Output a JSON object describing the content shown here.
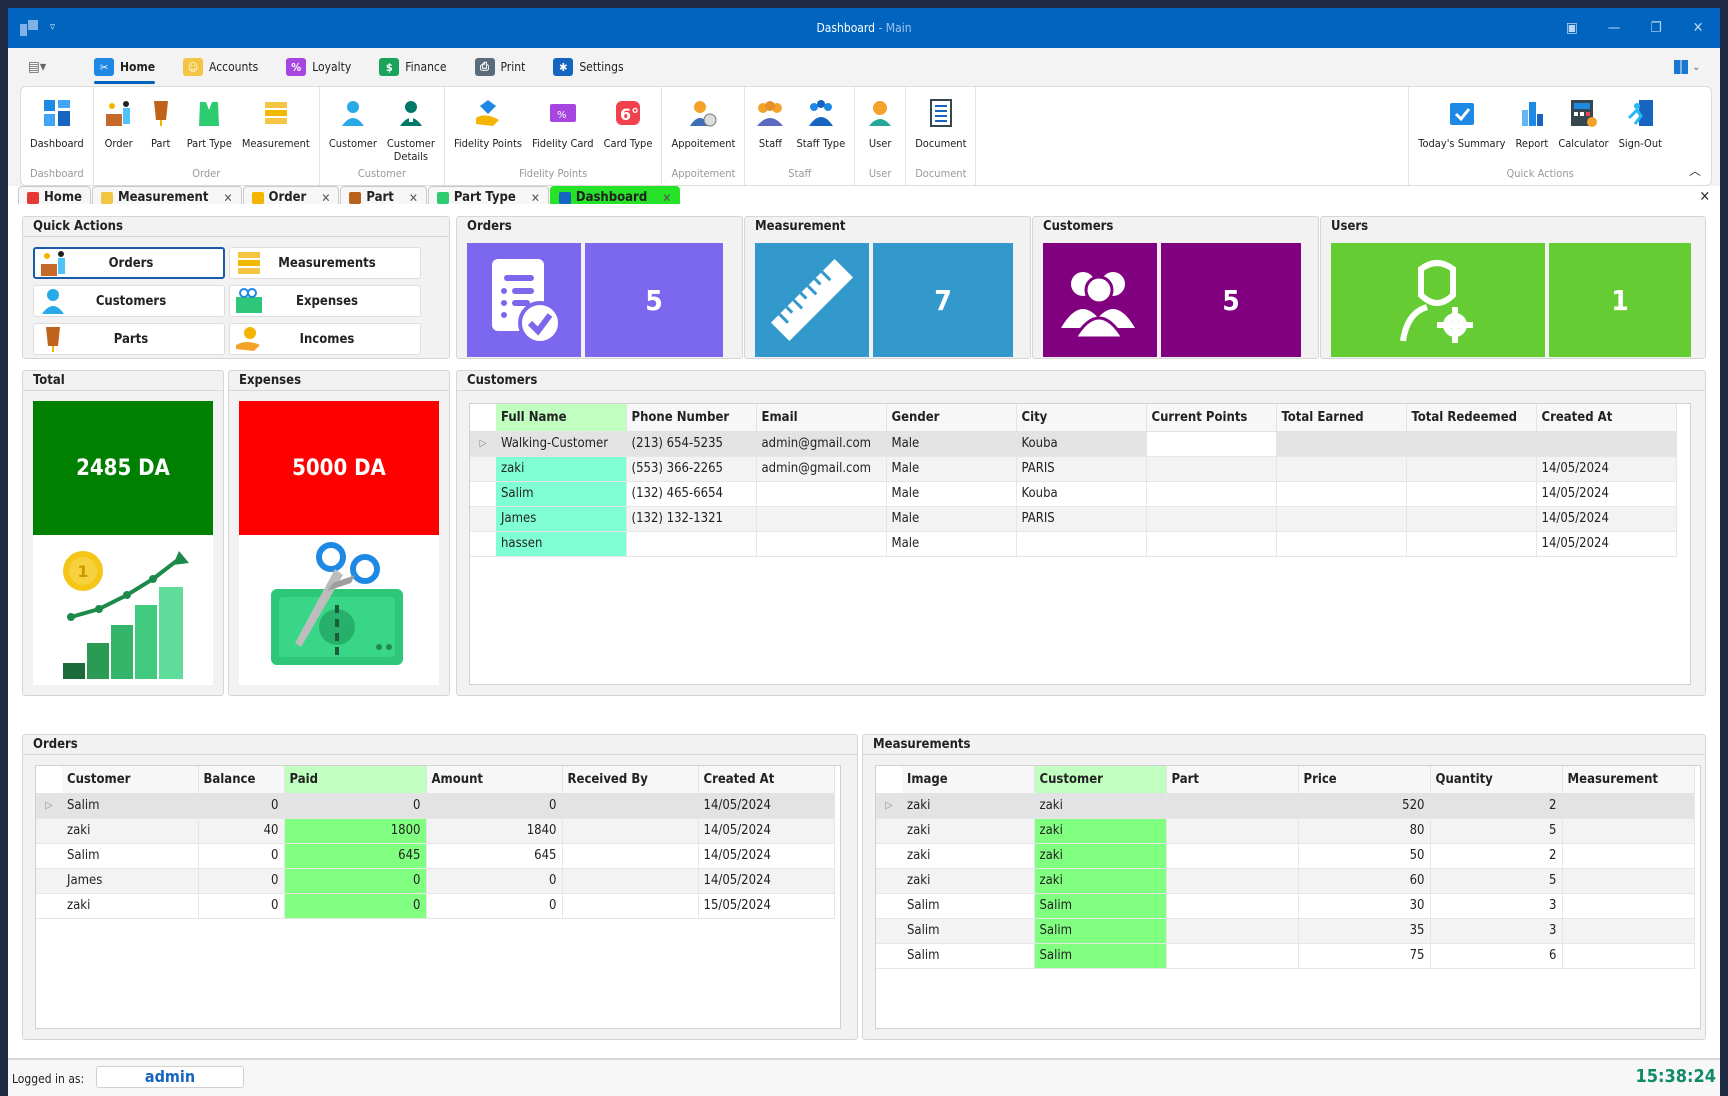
{
  "window": {
    "title": "Dashboard",
    "title_suffix": " - Main",
    "controls": [
      "restore-ribbon",
      "minimize",
      "maximize",
      "close"
    ]
  },
  "ribbon_tabs": [
    {
      "label": "Home",
      "icon": "sewing-machine-icon",
      "active": true,
      "color": "#1e88e5"
    },
    {
      "label": "Accounts",
      "icon": "folder-user-icon",
      "active": false,
      "color": "#f4c542"
    },
    {
      "label": "Loyalty",
      "icon": "percent-card-icon",
      "active": false,
      "color": "#a745e0"
    },
    {
      "label": "Finance",
      "icon": "dollar-icon",
      "active": false,
      "color": "#1aa35a"
    },
    {
      "label": "Print",
      "icon": "printer-icon",
      "active": false,
      "color": "#5a6b7b"
    },
    {
      "label": "Settings",
      "icon": "gear-icon",
      "active": false,
      "color": "#1565c0"
    }
  ],
  "ribbon_groups": [
    {
      "label": "Dashboard",
      "items": [
        {
          "label": "Dashboard",
          "icon": "dashboard-icon"
        }
      ]
    },
    {
      "label": "Order",
      "items": [
        {
          "label": "Order",
          "icon": "order-desk-icon"
        },
        {
          "label": "Part",
          "icon": "mannequin-icon"
        },
        {
          "label": "Part Type",
          "icon": "vest-icon"
        },
        {
          "label": "Measurement",
          "icon": "tape-measure-icon"
        }
      ]
    },
    {
      "label": "Customer",
      "items": [
        {
          "label": "Customer",
          "icon": "customer-icon"
        },
        {
          "label": "Customer\nDetails",
          "icon": "customer-details-icon"
        }
      ]
    },
    {
      "label": "Fidelity Points",
      "items": [
        {
          "label": "Fidelity Points",
          "icon": "diamond-hand-icon"
        },
        {
          "label": "Fidelity Card",
          "icon": "fidelity-card-icon"
        },
        {
          "label": "Card Type",
          "icon": "card-type-icon"
        }
      ]
    },
    {
      "label": "Appoitement",
      "items": [
        {
          "label": "Appoitement",
          "icon": "appointment-icon"
        }
      ]
    },
    {
      "label": "Staff",
      "items": [
        {
          "label": "Staff",
          "icon": "staff-icon"
        },
        {
          "label": "Staff Type",
          "icon": "staff-type-icon"
        }
      ]
    },
    {
      "label": "User",
      "items": [
        {
          "label": "User",
          "icon": "user-icon"
        }
      ]
    },
    {
      "label": "Document",
      "items": [
        {
          "label": "Document",
          "icon": "document-icon"
        }
      ]
    },
    {
      "label": "Quick Actions",
      "items": [
        {
          "label": "Today's Summary",
          "icon": "calendar-check-icon"
        },
        {
          "label": "Report",
          "icon": "bar-report-icon"
        },
        {
          "label": "Calculator",
          "icon": "calculator-icon"
        },
        {
          "label": "Sign-Out",
          "icon": "sign-out-icon"
        }
      ]
    }
  ],
  "doc_tabs": [
    {
      "label": "Home",
      "closable": false,
      "active": false,
      "color": "#e53935"
    },
    {
      "label": "Measurement",
      "closable": true,
      "active": false,
      "color": "#f4c542"
    },
    {
      "label": "Order",
      "closable": true,
      "active": false,
      "color": "#f4b400"
    },
    {
      "label": "Part",
      "closable": true,
      "active": false,
      "color": "#b8621b"
    },
    {
      "label": "Part Type",
      "closable": true,
      "active": false,
      "color": "#2ecc71"
    },
    {
      "label": "Dashboard",
      "closable": true,
      "active": true,
      "color": "#1565c0"
    }
  ],
  "quick_actions": {
    "title": "Quick Actions",
    "buttons": [
      {
        "label": "Orders",
        "icon": "order-desk-icon",
        "selected": true
      },
      {
        "label": "Measurements",
        "icon": "tape-measure-icon",
        "selected": false
      },
      {
        "label": "Customers",
        "icon": "customer-icon",
        "selected": false
      },
      {
        "label": "Expenses",
        "icon": "scissors-cash-icon",
        "selected": false
      },
      {
        "label": "Parts",
        "icon": "mannequin-icon",
        "selected": false
      },
      {
        "label": "Incomes",
        "icon": "coin-hand-icon",
        "selected": false
      }
    ]
  },
  "stats": [
    {
      "title": "Orders",
      "value": "5",
      "color": "#7b68ee",
      "icon": "order-check-icon"
    },
    {
      "title": "Measurement",
      "value": "7",
      "color": "#3399cc",
      "icon": "ruler-icon"
    },
    {
      "title": "Customers",
      "value": "5",
      "color": "#800080",
      "icon": "users-icon"
    },
    {
      "title": "Users",
      "value": "1",
      "color": "#66cc33",
      "icon": "user-gear-icon"
    }
  ],
  "total": {
    "title": "Total",
    "value": "2485 DA",
    "color": "#008000",
    "icon": "growth-chart-icon"
  },
  "expenses": {
    "title": "Expenses",
    "value": "5000 DA",
    "color": "#ff0000",
    "icon": "scissors-cash-icon"
  },
  "customers_grid": {
    "title": "Customers",
    "columns": [
      "Full Name",
      "Phone Number",
      "Email",
      "Gender",
      "City",
      "Current Points",
      "Total Earned",
      "Total Redeemed",
      "Created At"
    ],
    "rows": [
      [
        "Walking-Customer",
        "(213) 654-5235",
        "admin@gmail.com",
        "Male",
        "Kouba",
        "",
        "",
        "",
        ""
      ],
      [
        "zaki",
        "(553) 366-2265",
        "admin@gmail.com",
        "Male",
        "PARIS",
        "",
        "",
        "",
        "14/05/2024"
      ],
      [
        "Salim",
        "(132) 465-6654",
        "",
        "Male",
        "Kouba",
        "",
        "",
        "",
        "14/05/2024"
      ],
      [
        "James",
        "(132) 132-1321",
        "",
        "Male",
        "PARIS",
        "",
        "",
        "",
        "14/05/2024"
      ],
      [
        "hassen",
        "",
        "",
        "Male",
        "",
        "",
        "",
        "",
        "14/05/2024"
      ]
    ]
  },
  "orders_grid": {
    "title": "Orders",
    "columns": [
      "Customer",
      "Balance",
      "Paid",
      "Amount",
      "Received By",
      "Created At"
    ],
    "rows": [
      [
        "Salim",
        "0",
        "0",
        "0",
        "",
        "14/05/2024"
      ],
      [
        "zaki",
        "40",
        "1800",
        "1840",
        "",
        "14/05/2024"
      ],
      [
        "Salim",
        "0",
        "645",
        "645",
        "",
        "14/05/2024"
      ],
      [
        "James",
        "0",
        "0",
        "0",
        "",
        "14/05/2024"
      ],
      [
        "zaki",
        "0",
        "0",
        "0",
        "",
        "15/05/2024"
      ]
    ]
  },
  "measurements_grid": {
    "title": "Measurements",
    "columns": [
      "Image",
      "Customer",
      "Part",
      "Price",
      "Quantity",
      "Measurement"
    ],
    "rows": [
      [
        "zaki",
        "zaki",
        "",
        "520",
        "2",
        ""
      ],
      [
        "zaki",
        "zaki",
        "",
        "80",
        "5",
        ""
      ],
      [
        "zaki",
        "zaki",
        "",
        "50",
        "2",
        ""
      ],
      [
        "zaki",
        "zaki",
        "",
        "60",
        "5",
        ""
      ],
      [
        "Salim",
        "Salim",
        "",
        "30",
        "3",
        ""
      ],
      [
        "Salim",
        "Salim",
        "",
        "35",
        "3",
        ""
      ],
      [
        "Salim",
        "Salim",
        "",
        "75",
        "6",
        ""
      ]
    ]
  },
  "statusbar": {
    "logged_in_label": "Logged in as:",
    "username": "admin",
    "clock": "15:38:24"
  }
}
